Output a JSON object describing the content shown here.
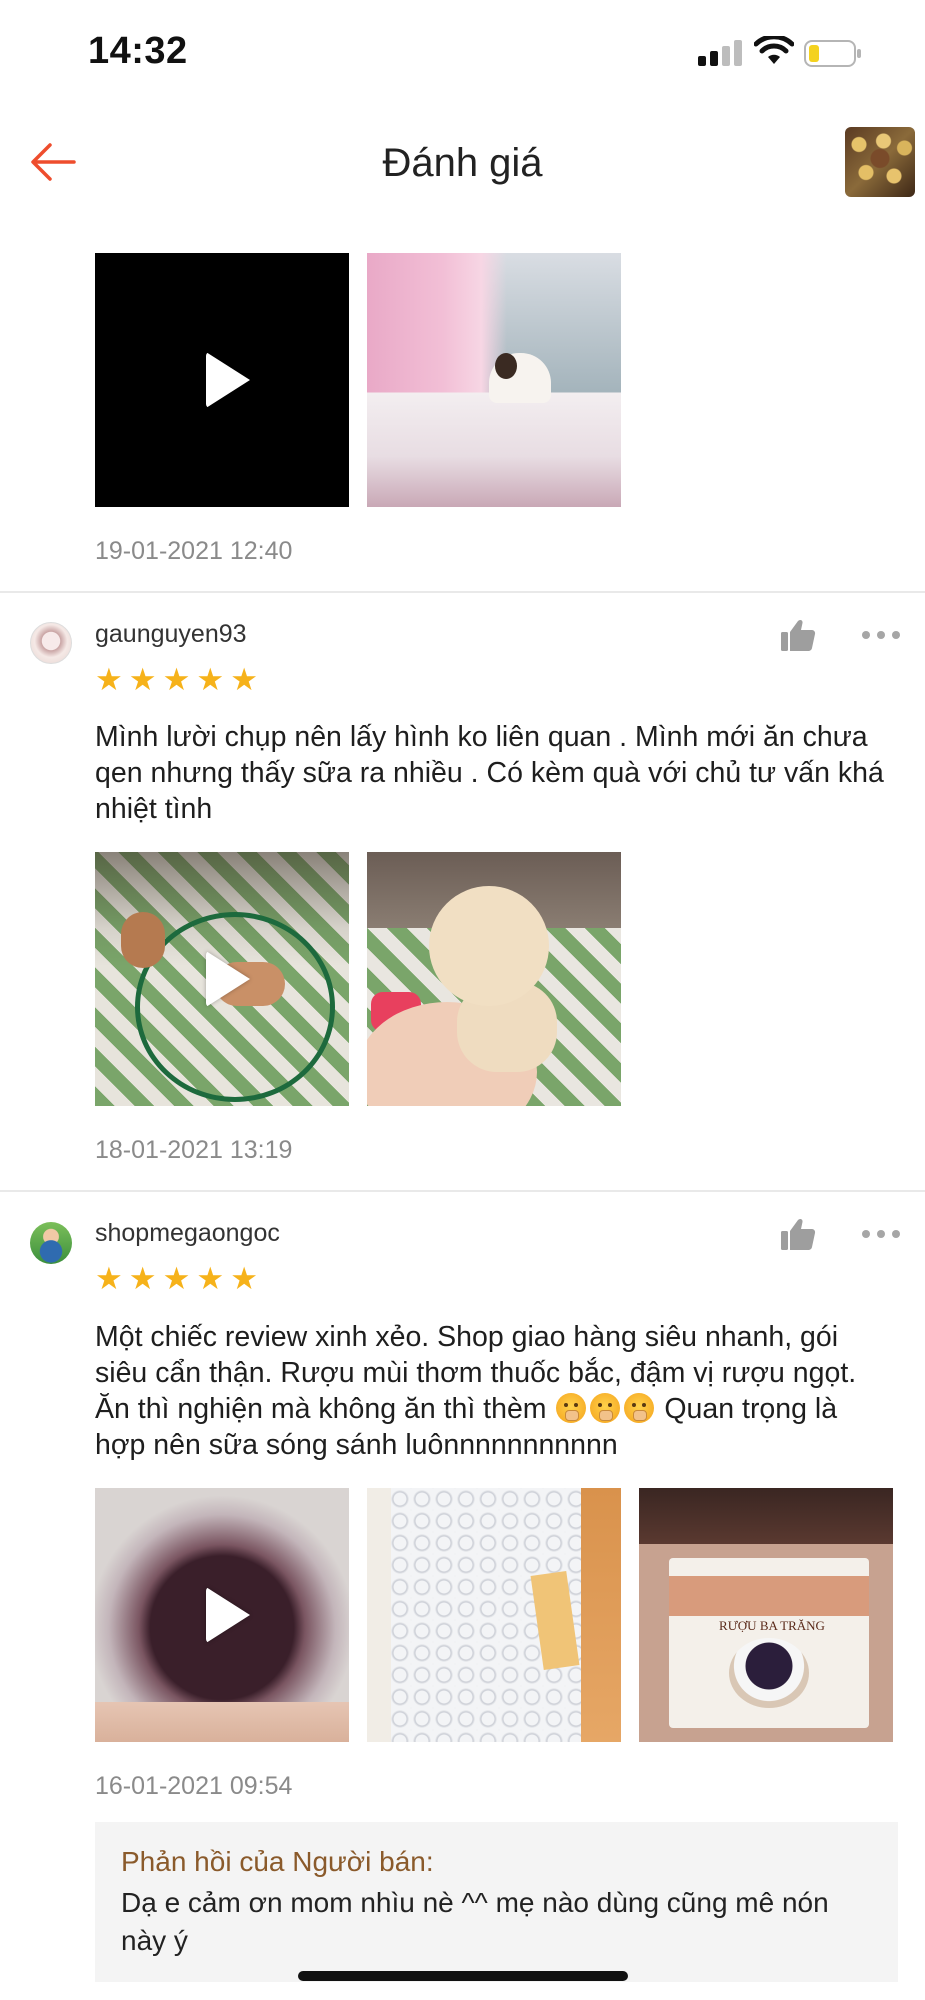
{
  "status_bar": {
    "time": "14:32"
  },
  "header": {
    "title": "Đánh giá"
  },
  "reviews": [
    {
      "date": "19-01-2021 12:40",
      "media": [
        {
          "kind": "video"
        },
        {
          "kind": "photo"
        }
      ]
    },
    {
      "username": "gaunguyen93",
      "rating": 5,
      "stars": [
        "★",
        "★",
        "★",
        "★",
        "★"
      ],
      "text": "Mình lười chụp nên lấy hình ko liên quan . Mình mới ăn chưa qen nhưng thấy sữa ra nhiều . Có kèm quà với chủ tư vấn khá nhiệt tình",
      "date": "18-01-2021 13:19",
      "media": [
        {
          "kind": "video"
        },
        {
          "kind": "photo"
        }
      ]
    },
    {
      "username": "shopmegaongoc",
      "rating": 5,
      "stars": [
        "★",
        "★",
        "★",
        "★",
        "★"
      ],
      "text_before_emoji": "Một chiếc review xinh xẻo. Shop giao hàng siêu nhanh, gói siêu cẩn thận. Rượu mùi thơm thuốc bắc, đậm vị rượu ngọt. Ăn thì nghiện mà không ăn thì thèm",
      "text_after_emoji": "Quan trọng là hợp nên sữa sóng sánh luônnnnnnnnnnn",
      "emoji_count": 3,
      "date": "16-01-2021 09:54",
      "media": [
        {
          "kind": "video"
        },
        {
          "kind": "photo"
        },
        {
          "kind": "photo",
          "label_text": "RƯỢU BA TRĂNG"
        }
      ],
      "seller_reply": {
        "title": "Phản hồi của Người bán:",
        "text": "Dạ e cảm ơn mom nhìu nè ^^ mẹ nào dùng cũng mê nón này ý"
      }
    }
  ],
  "colors": {
    "accent": "#ee4d2d",
    "star": "#f6b21a",
    "seller_title": "#8a5a2b",
    "date": "#8a8a8a"
  },
  "icons": [
    "back-arrow-icon",
    "like-icon",
    "more-icon",
    "play-icon",
    "signal-icon",
    "wifi-icon",
    "battery-icon"
  ]
}
